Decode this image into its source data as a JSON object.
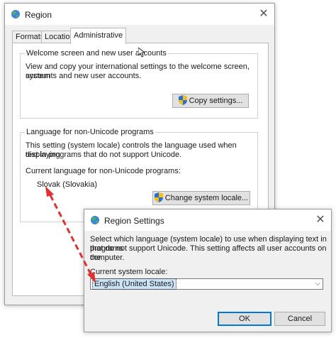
{
  "region": {
    "title": "Region",
    "tabs": [
      "Formats",
      "Location",
      "Administrative"
    ],
    "welcome_group": {
      "title": "Welcome screen and new user accounts",
      "description_line1": "View and copy your international settings to the welcome screen, system",
      "description_line2": "accounts and new user accounts.",
      "copy_button": "Copy settings..."
    },
    "unicode_group": {
      "title": "Language for non-Unicode programs",
      "description_line1": "This setting (system locale) controls the language used when displaying",
      "description_line2": "text in programs that do not support Unicode.",
      "current_label": "Current language for non-Unicode programs:",
      "current_value": "Slovak (Slovakia)",
      "change_button": "Change system locale..."
    }
  },
  "dialog": {
    "title": "Region Settings",
    "description_line1": "Select which language (system locale) to use when displaying text in programs",
    "description_line2": "that do not support Unicode. This setting affects all user accounts on the",
    "description_line3": "computer.",
    "locale_label": "Current system locale:",
    "locale_value": "English (United States)",
    "ok_button": "OK",
    "cancel_button": "Cancel"
  },
  "icons": {
    "close": "close-icon",
    "globe": "globe-icon",
    "shield": "uac-shield-icon",
    "dropdown": "chevron-down-icon"
  },
  "colors": {
    "accent": "#0078d7",
    "annotation_arrow": "#e03030"
  }
}
